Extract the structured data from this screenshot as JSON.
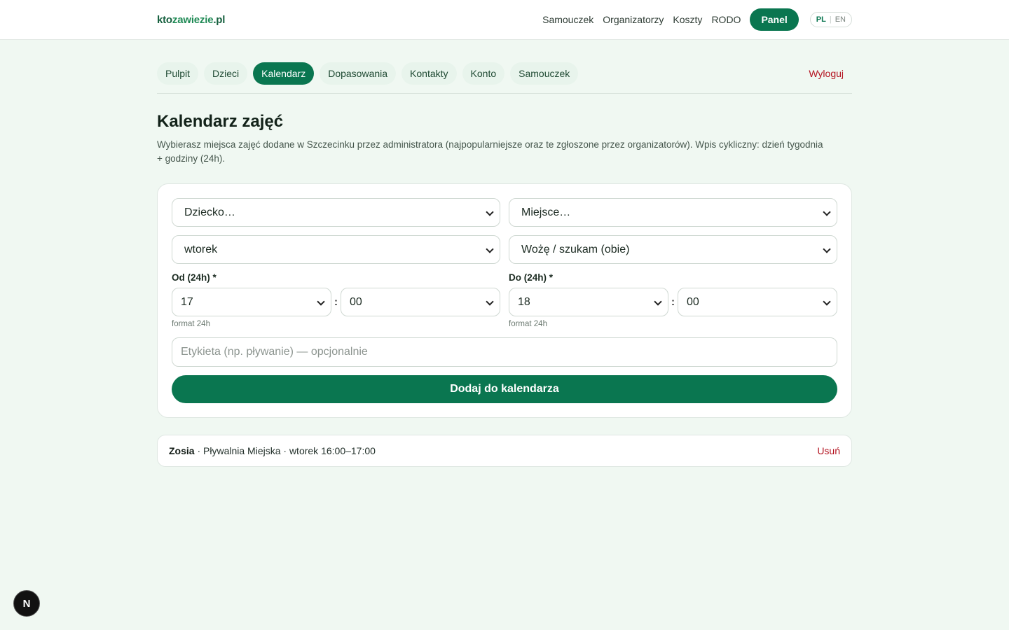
{
  "brand": {
    "part1": "kto",
    "part2": "zawiezie",
    "part3": ".pl"
  },
  "topnav": {
    "items": [
      "Samouczek",
      "Organizatorzy",
      "Koszty",
      "RODO"
    ],
    "panel": "Panel",
    "lang_active": "PL",
    "lang_sep": "|",
    "lang_other": "EN"
  },
  "tabs": [
    "Pulpit",
    "Dzieci",
    "Kalendarz",
    "Dopasowania",
    "Kontakty",
    "Konto",
    "Samouczek"
  ],
  "active_tab": "Kalendarz",
  "logout": "Wyloguj",
  "page": {
    "title": "Kalendarz zajęć",
    "description": "Wybierasz miejsca zajęć dodane w Szczecinku przez administratora (najpopularniejsze oraz te zgłoszone przez organizatorów). Wpis cykliczny: dzień tygodnia + godziny (24h)."
  },
  "form": {
    "child_select": "Dziecko…",
    "place_select": "Miejsce…",
    "day_select": "wtorek",
    "mode_select": "Wożę / szukam (obie)",
    "from_label": "Od (24h) *",
    "from_hour": "17",
    "from_minute": "00",
    "to_label": "Do (24h) *",
    "to_hour": "18",
    "to_minute": "00",
    "colon": ":",
    "format_hint": "format 24h",
    "label_placeholder": "Etykieta (np. pływanie) — opcjonalnie",
    "submit": "Dodaj do kalendarza"
  },
  "entries": [
    {
      "child": "Zosia",
      "details": " · Pływalnia Miejska · wtorek 16:00–17:00",
      "remove": "Usuń"
    }
  ],
  "dev_badge": "N",
  "colors": {
    "accent": "#0a7650",
    "danger": "#b3121f",
    "background": "#f0f8f2"
  },
  "icons": [
    "chevron-down-icon"
  ]
}
